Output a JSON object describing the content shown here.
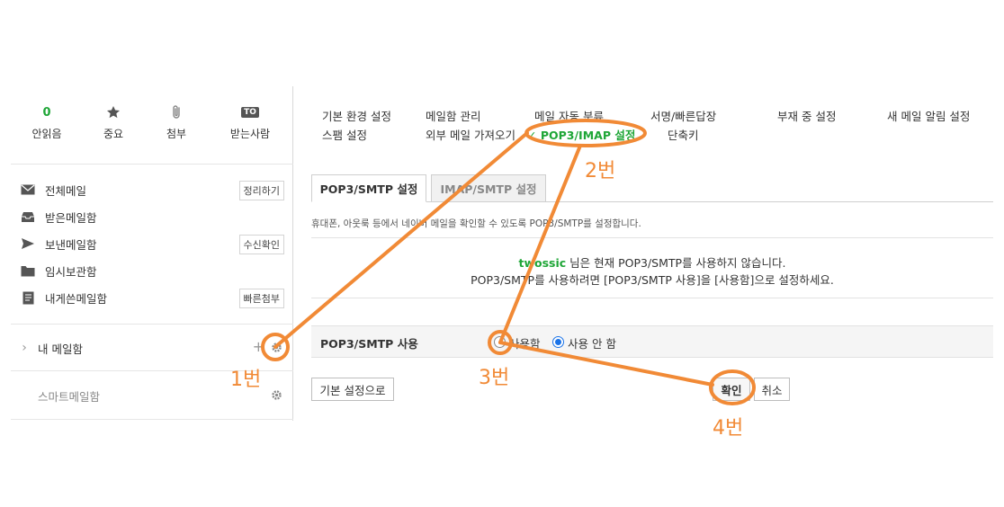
{
  "sidebar": {
    "quick": {
      "unread_count": "0",
      "unread_label": "안읽음",
      "important_label": "중요",
      "attach_label": "첨부",
      "to_badge": "TO",
      "recipient_label": "받는사람"
    },
    "folders": [
      {
        "label": "전체메일",
        "button": "정리하기",
        "icon": "envelope-icon"
      },
      {
        "label": "받은메일함",
        "icon": "inbox-icon"
      },
      {
        "label": "보낸메일함",
        "button": "수신확인",
        "icon": "send-icon"
      },
      {
        "label": "임시보관함",
        "icon": "folder-icon"
      },
      {
        "label": "내게쓴메일함",
        "button": "빠른첨부",
        "icon": "memo-icon"
      }
    ],
    "my_mailbox": {
      "chevron": "›",
      "label": "내 메일함",
      "add": "+"
    },
    "smart_mailbox": {
      "label": "스마트메일함"
    }
  },
  "menu": {
    "row1": [
      "기본 환경 설정",
      "메일함 관리",
      "메일 자동 분류",
      "서명/빠른답장",
      "부재 중 설정",
      "새 메일 알림 설정"
    ],
    "row2": [
      "스팸 설정",
      "외부 메일 가져오기",
      "POP3/IMAP 설정",
      "단축키"
    ],
    "active_check": "✓"
  },
  "tabs": {
    "pop3": "POP3/SMTP 설정",
    "imap": "IMAP/SMTP 설정"
  },
  "description": "휴대폰, 아웃룩 등에서 네이버 메일을 확인할 수 있도록 POP3/SMTP를 설정합니다.",
  "status": {
    "user_id": "twossic",
    "line1_rest": " 님은 현재 POP3/SMTP를 사용하지 않습니다.",
    "line2": "POP3/SMTP를 사용하려면 [POP3/SMTP 사용]을 [사용함]으로 설정하세요."
  },
  "setting": {
    "label": "POP3/SMTP 사용",
    "option_use": "사용함",
    "option_not_use": "사용 안 함",
    "selected": "사용 안 함"
  },
  "buttons": {
    "reset": "기본 설정으로",
    "confirm": "확인",
    "cancel": "취소"
  },
  "annotations": {
    "step1": "1번",
    "step2": "2번",
    "step3": "3번",
    "step4": "4번"
  },
  "colors": {
    "accent_green": "#1fa637",
    "annotation_orange": "#f18a36",
    "radio_blue": "#1a73e8"
  }
}
